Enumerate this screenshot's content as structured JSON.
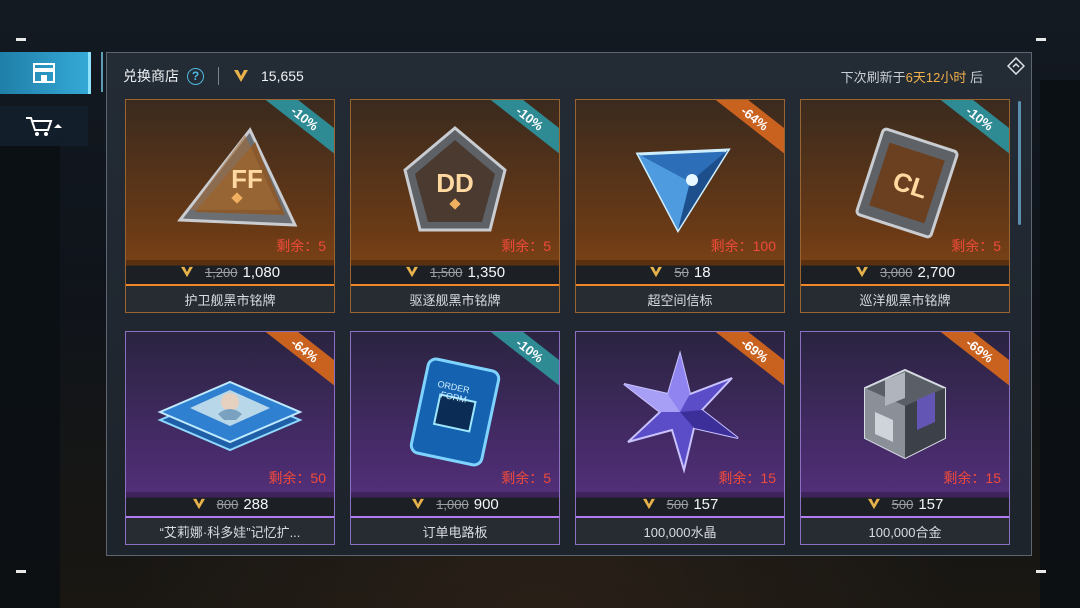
{
  "sidebar": {
    "tabs": [
      {
        "icon": "shop-icon",
        "active": true
      },
      {
        "icon": "cart-icon",
        "active": false
      }
    ]
  },
  "header": {
    "title": "兑换商店",
    "help": "?",
    "currency_icon": "v-currency-icon",
    "balance": "15,655",
    "refresh_prefix": "下次刷新于",
    "refresh_time": "6天12小时",
    "refresh_suffix": " 后"
  },
  "colors": {
    "accent_blue": "#35a9d6",
    "currency_gold": "#e8b24a",
    "remain_red": "#ef4a3a",
    "badge_teal": "#2e8a93",
    "badge_orange": "#c9611f"
  },
  "items": [
    {
      "name": "护卫舰黑市铭牌",
      "discount": "-10%",
      "badge": "teal",
      "rarity": "orange",
      "remain": "剩余：5",
      "old_price": "1,200",
      "price": "1,080",
      "art": "ff-plate-icon"
    },
    {
      "name": "驱逐舰黑市铭牌",
      "discount": "-10%",
      "badge": "teal",
      "rarity": "orange",
      "remain": "剩余：5",
      "old_price": "1,500",
      "price": "1,350",
      "art": "dd-plate-icon"
    },
    {
      "name": "超空间信标",
      "discount": "-64%",
      "badge": "orange",
      "rarity": "orange",
      "remain": "剩余：100",
      "old_price": "50",
      "price": "18",
      "art": "beacon-icon"
    },
    {
      "name": "巡洋舰黑市铭牌",
      "discount": "-10%",
      "badge": "teal",
      "rarity": "orange",
      "remain": "剩余：5",
      "old_price": "3,000",
      "price": "2,700",
      "art": "cl-plate-icon"
    },
    {
      "name": "“艾莉娜·科多娃”记忆扩...",
      "discount": "-64%",
      "badge": "orange",
      "rarity": "purple",
      "remain": "剩余：50",
      "old_price": "800",
      "price": "288",
      "art": "memory-card-icon"
    },
    {
      "name": "订单电路板",
      "discount": "-10%",
      "badge": "teal",
      "rarity": "purple",
      "remain": "剩余：5",
      "old_price": "1,000",
      "price": "900",
      "art": "circuit-board-icon"
    },
    {
      "name": "100,000水晶",
      "discount": "-69%",
      "badge": "orange",
      "rarity": "purple",
      "remain": "剩余：15",
      "old_price": "500",
      "price": "157",
      "art": "crystal-icon"
    },
    {
      "name": "100,000合金",
      "discount": "-69%",
      "badge": "orange",
      "rarity": "purple",
      "remain": "剩余：15",
      "old_price": "500",
      "price": "157",
      "art": "alloy-icon"
    }
  ]
}
